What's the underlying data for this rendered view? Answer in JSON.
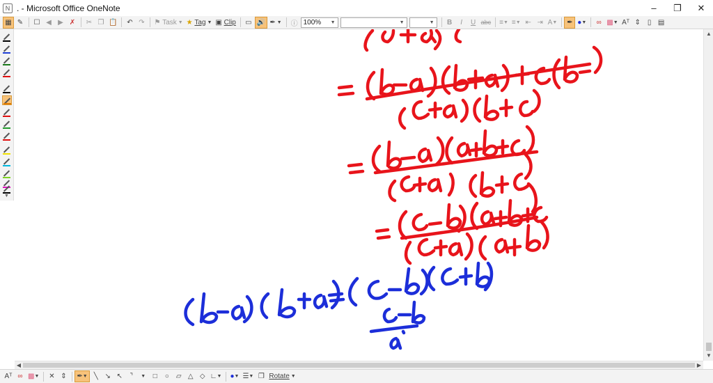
{
  "window": {
    "title": ". - Microsoft Office OneNote",
    "controls": [
      "minimize",
      "restore",
      "close"
    ]
  },
  "toolbar": {
    "task_label": "Task",
    "tag_label": "Tag",
    "clip_label": "Clip",
    "zoom_value": "100%",
    "font_value": "",
    "size_value": "",
    "bold": "B",
    "italic": "I",
    "underline": "U",
    "strike": "abc"
  },
  "bottombar": {
    "rotate_label": "Rotate"
  },
  "pens": [
    {
      "name": "pen-black",
      "color": "#000000"
    },
    {
      "name": "pen-blue",
      "color": "#1f3fd6"
    },
    {
      "name": "pen-darkgreen",
      "color": "#1a7a1a"
    },
    {
      "name": "pen-red",
      "color": "#e01010"
    },
    {
      "name": "pen-black-2",
      "color": "#000000"
    },
    {
      "name": "pen-orange-active",
      "color": "#e07b00"
    },
    {
      "name": "pen-red-2",
      "color": "#e01010"
    },
    {
      "name": "pen-green",
      "color": "#1f9a2a"
    },
    {
      "name": "pen-red-3",
      "color": "#e01010"
    },
    {
      "name": "pen-yellow",
      "color": "#f0e000"
    },
    {
      "name": "pen-cyan",
      "color": "#00b8e0"
    },
    {
      "name": "pen-lime",
      "color": "#7ed321"
    },
    {
      "name": "pen-magenta",
      "color": "#e010c0"
    },
    {
      "name": "pen-black-3",
      "color": "#000000"
    }
  ],
  "colors": {
    "ink_red": "#e8141b",
    "ink_blue": "#1c2ed9",
    "active_highlight": "#f7c27a"
  }
}
